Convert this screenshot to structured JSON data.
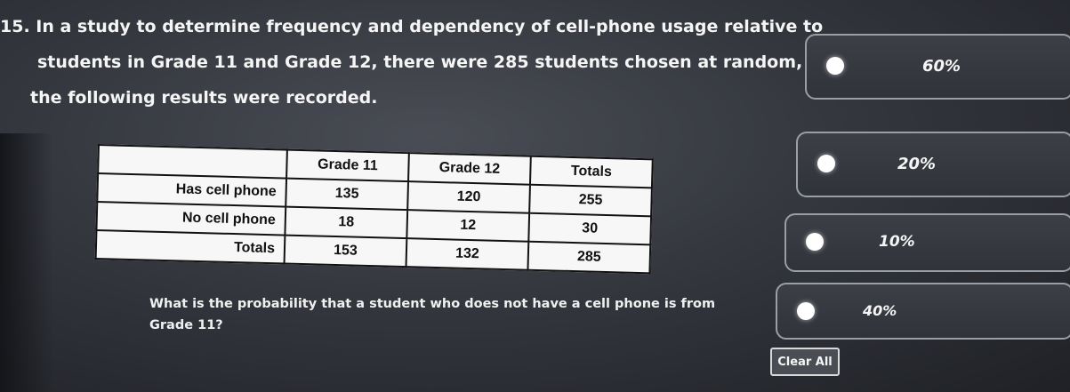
{
  "question": {
    "line1": "15. In a study to determine frequency and dependency of cell-phone usage relative to",
    "line2": "students in Grade 11 and Grade 12, there were 285 students chosen at random, and",
    "line3": "the following results were recorded."
  },
  "table": {
    "headers": [
      "",
      "Grade 11",
      "Grade 12",
      "Totals"
    ],
    "rows": [
      {
        "label": "Has cell phone",
        "values": [
          "135",
          "120",
          "255"
        ]
      },
      {
        "label": "No cell phone",
        "values": [
          "18",
          "12",
          "30"
        ]
      },
      {
        "label": "Totals",
        "values": [
          "153",
          "132",
          "285"
        ]
      }
    ]
  },
  "sub_question": "What is the probability that a student who does not have a cell phone is from Grade 11?",
  "options": [
    {
      "label": "60%"
    },
    {
      "label": "20%"
    },
    {
      "label": "10%"
    },
    {
      "label": "40%"
    }
  ],
  "clear_all_label": "Clear All"
}
